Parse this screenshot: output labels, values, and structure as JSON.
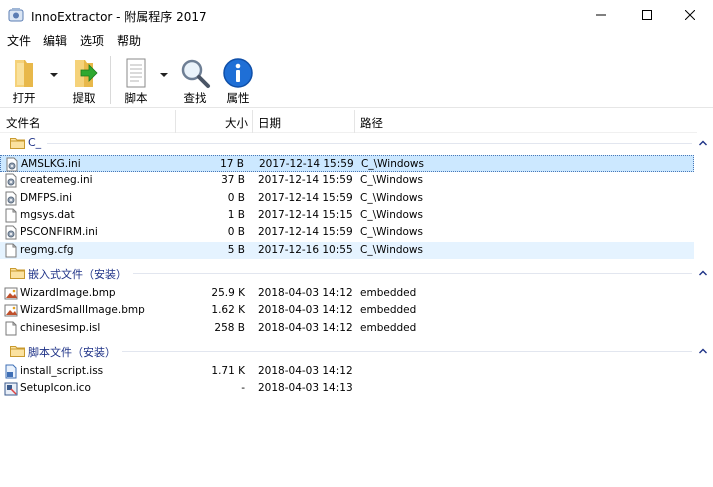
{
  "window": {
    "title": "InnoExtractor - 附属程序 2017",
    "app_icon": "innoextractor-icon"
  },
  "menu": [
    "文件",
    "编辑",
    "选项",
    "帮助"
  ],
  "toolbar": {
    "open": "打开",
    "extract": "提取",
    "script": "脚本",
    "find": "查找",
    "properties": "属性"
  },
  "columns": {
    "name": "文件名",
    "size": "大小",
    "date": "日期",
    "path": "路径"
  },
  "groups": [
    {
      "label": "C_",
      "rows": [
        {
          "name": "AMSLKG.ini",
          "size": "17 B",
          "date": "2017-12-14 15:59",
          "path": "C_\\Windows",
          "icon": "ini-file-icon",
          "state": "selected"
        },
        {
          "name": "createmeg.ini",
          "size": "37 B",
          "date": "2017-12-14 15:59",
          "path": "C_\\Windows",
          "icon": "ini-file-icon",
          "state": ""
        },
        {
          "name": "DMFPS.ini",
          "size": "0 B",
          "date": "2017-12-14 15:59",
          "path": "C_\\Windows",
          "icon": "ini-file-icon",
          "state": ""
        },
        {
          "name": "mgsys.dat",
          "size": "1 B",
          "date": "2017-12-14 15:15",
          "path": "C_\\Windows",
          "icon": "blank-file-icon",
          "state": ""
        },
        {
          "name": "PSCONFIRM.ini",
          "size": "0 B",
          "date": "2017-12-14 15:59",
          "path": "C_\\Windows",
          "icon": "ini-file-icon",
          "state": ""
        },
        {
          "name": "regmg.cfg",
          "size": "5 B",
          "date": "2017-12-16 10:55",
          "path": "C_\\Windows",
          "icon": "blank-file-icon",
          "state": "hover"
        }
      ]
    },
    {
      "label": "嵌入式文件（安装）",
      "rows": [
        {
          "name": "WizardImage.bmp",
          "size": "25.9 K",
          "date": "2018-04-03 14:12",
          "path": "embedded",
          "icon": "bitmap-file-icon",
          "state": ""
        },
        {
          "name": "WizardSmallImage.bmp",
          "size": "1.62 K",
          "date": "2018-04-03 14:12",
          "path": "embedded",
          "icon": "bitmap-file-icon",
          "state": ""
        },
        {
          "name": "chinesesimp.isl",
          "size": "258 B",
          "date": "2018-04-03 14:12",
          "path": "embedded",
          "icon": "blank-file-icon",
          "state": ""
        }
      ]
    },
    {
      "label": "脚本文件（安装）",
      "rows": [
        {
          "name": "install_script.iss",
          "size": "1.71 K",
          "date": "2018-04-03 14:12",
          "path": "",
          "icon": "script-file-icon",
          "state": ""
        },
        {
          "name": "SetupIcon.ico",
          "size": "-",
          "date": "2018-04-03 14:13",
          "path": "",
          "icon": "setup-icon-file-icon",
          "state": ""
        }
      ]
    }
  ]
}
